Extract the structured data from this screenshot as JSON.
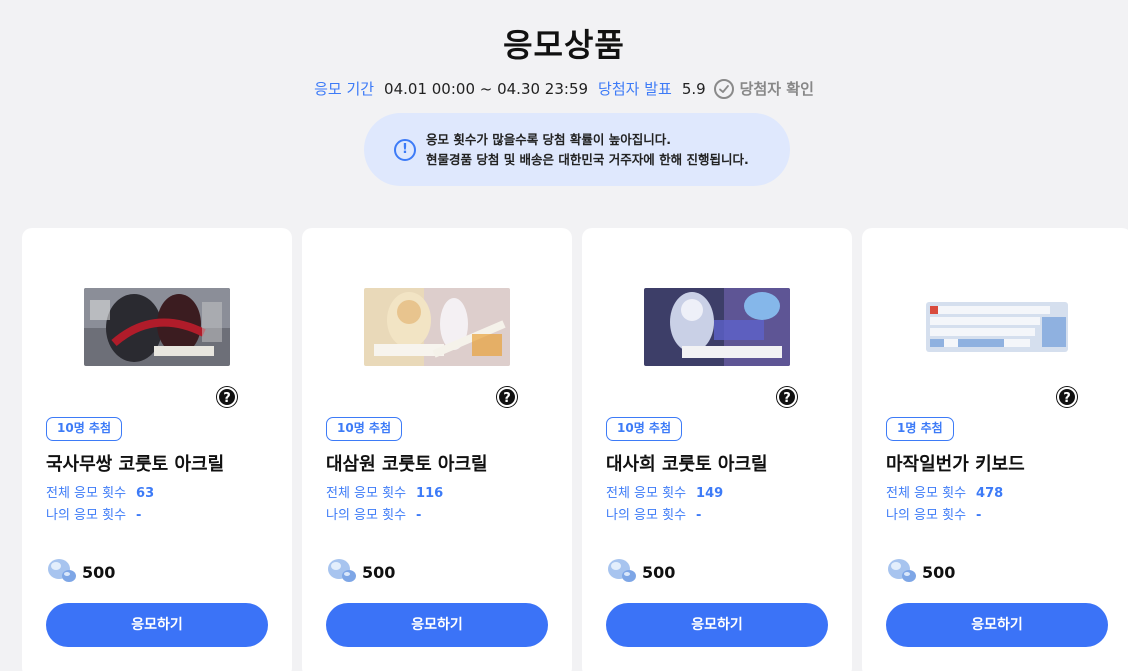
{
  "header": {
    "title": "응모상품",
    "period_label": "응모 기간",
    "period_value": "04.01 00:00 ~ 04.30 23:59",
    "announce_label": "당첨자 발표",
    "announce_value": "5.9",
    "winner_check_label": "당첨자 확인"
  },
  "notice": {
    "line1": "응모 횟수가 많을수록 당첨 확률이 높아집니다.",
    "line2": "현물경품 당첨 및 배송은 대한민국 거주자에 한해 진행됩니다."
  },
  "colors": {
    "accent": "#3d7bf7",
    "button": "#3b73f7",
    "notice_bg": "#dfe8fd"
  },
  "cards": [
    {
      "badge": "10명 추첨",
      "name": "국사무쌍 코룻토 아크릴",
      "total_label": "전체 응모 횟수",
      "total_value": "63",
      "my_label": "나의 응모 횟수",
      "my_value": "-",
      "cost": "500",
      "button": "응모하기"
    },
    {
      "badge": "10명 추첨",
      "name": "대삼원 코룻토 아크릴",
      "total_label": "전체 응모 횟수",
      "total_value": "116",
      "my_label": "나의 응모 횟수",
      "my_value": "-",
      "cost": "500",
      "button": "응모하기"
    },
    {
      "badge": "10명 추첨",
      "name": "대사희 코룻토 아크릴",
      "total_label": "전체 응모 횟수",
      "total_value": "149",
      "my_label": "나의 응모 횟수",
      "my_value": "-",
      "cost": "500",
      "button": "응모하기"
    },
    {
      "badge": "1명 추첨",
      "name": "마작일번가 키보드",
      "total_label": "전체 응모 횟수",
      "total_value": "478",
      "my_label": "나의 응모 횟수",
      "my_value": "-",
      "cost": "500",
      "button": "응모하기"
    }
  ]
}
